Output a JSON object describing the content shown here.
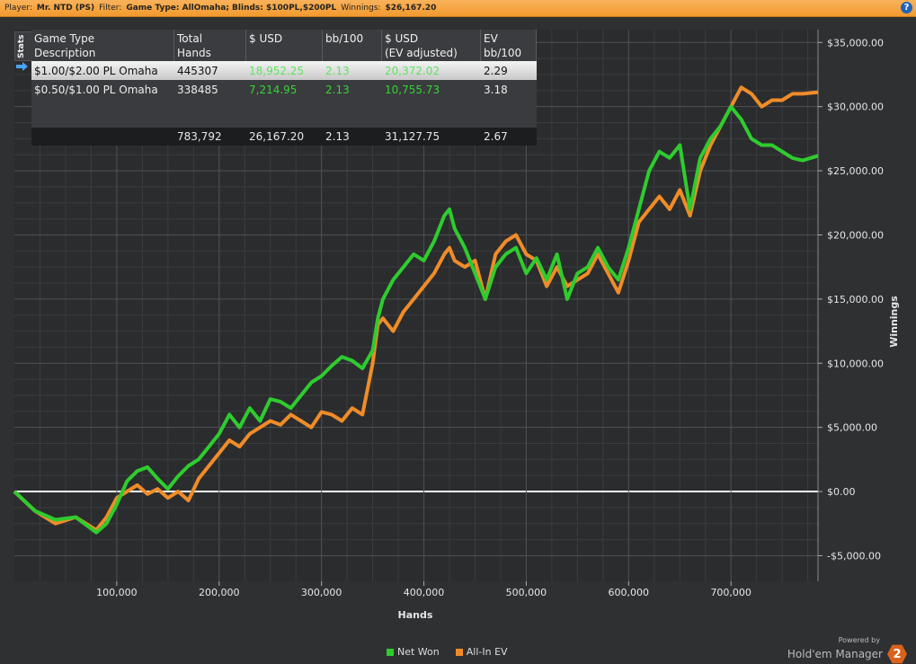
{
  "header": {
    "player_label": "Player:",
    "player_value": "Mr. NTD (PS)",
    "filter_label": "Filter:",
    "filter_value": "Game Type: AllOmaha; Blinds: $100PL,$200PL",
    "winnings_label": "Winnings:",
    "winnings_value": "$26,167.20",
    "help_glyph": "?"
  },
  "stats_tab": "Stats",
  "table": {
    "headers": [
      "Game Type\nDescription",
      "Total\nHands",
      "$ USD",
      "bb/100",
      "$ USD\n(EV adjusted)",
      "EV\nbb/100"
    ],
    "rows": [
      [
        "$1.00/$2.00 PL Omaha",
        "445307",
        "18,952.25",
        "2.13",
        "20,372.02",
        "2.29"
      ],
      [
        "$0.50/$1.00 PL Omaha",
        "338485",
        "7,214.95",
        "2.13",
        "10,755.73",
        "3.18"
      ]
    ],
    "totals": [
      "",
      "783,792",
      "26,167.20",
      "2.13",
      "31,127.75",
      "2.67"
    ]
  },
  "chart_data": {
    "type": "line",
    "xlabel": "Hands",
    "ylabel": "Winnings",
    "xlim": [
      0,
      785000
    ],
    "ylim": [
      -7000,
      36000
    ],
    "x_ticks": [
      100000,
      200000,
      300000,
      400000,
      500000,
      600000,
      700000
    ],
    "x_tick_labels": [
      "100,000",
      "200,000",
      "300,000",
      "400,000",
      "500,000",
      "600,000",
      "700,000"
    ],
    "y_ticks": [
      35000,
      30000,
      25000,
      20000,
      15000,
      10000,
      5000,
      0,
      -5000
    ],
    "y_tick_labels": [
      "$35,000.00",
      "$30,000.00",
      "$25,000.00",
      "$20,000.00",
      "$15,000.00",
      "$10,000.00",
      "$5,000.00",
      "$0.00",
      "-$5,000.00"
    ],
    "grid": true,
    "legend": "bottom-center",
    "series": [
      {
        "name": "Net Won",
        "color": "#2ecc2e",
        "x": [
          0,
          20000,
          40000,
          60000,
          80000,
          90000,
          100000,
          110000,
          120000,
          130000,
          140000,
          150000,
          160000,
          170000,
          180000,
          190000,
          200000,
          210000,
          220000,
          230000,
          240000,
          250000,
          260000,
          270000,
          280000,
          290000,
          300000,
          310000,
          320000,
          330000,
          340000,
          350000,
          355000,
          360000,
          370000,
          380000,
          390000,
          400000,
          410000,
          420000,
          425000,
          430000,
          440000,
          450000,
          460000,
          470000,
          480000,
          490000,
          500000,
          510000,
          520000,
          530000,
          540000,
          550000,
          560000,
          570000,
          580000,
          590000,
          600000,
          610000,
          620000,
          630000,
          640000,
          650000,
          660000,
          670000,
          680000,
          690000,
          700000,
          710000,
          720000,
          730000,
          740000,
          750000,
          760000,
          770000,
          785000
        ],
        "y": [
          0,
          -1500,
          -2200,
          -2000,
          -3200,
          -2500,
          -1000,
          800,
          1600,
          1900,
          1000,
          200,
          1200,
          2000,
          2500,
          3500,
          4500,
          6000,
          5000,
          6500,
          5500,
          7200,
          7000,
          6500,
          7500,
          8500,
          9000,
          9800,
          10500,
          10200,
          9600,
          11000,
          13500,
          15000,
          16500,
          17500,
          18500,
          18000,
          19500,
          21500,
          22000,
          20500,
          19000,
          17000,
          15000,
          17500,
          18500,
          19000,
          17000,
          18200,
          16500,
          18500,
          15000,
          17000,
          17500,
          19000,
          17500,
          16500,
          19000,
          22000,
          25000,
          26500,
          26000,
          27000,
          22000,
          26000,
          27500,
          28500,
          30000,
          29000,
          27500,
          27000,
          27000,
          26500,
          26000,
          25800,
          26167
        ]
      },
      {
        "name": "All-In EV",
        "color": "#f08c28",
        "x": [
          0,
          20000,
          40000,
          60000,
          80000,
          90000,
          100000,
          110000,
          120000,
          130000,
          140000,
          150000,
          160000,
          170000,
          180000,
          190000,
          200000,
          210000,
          220000,
          230000,
          240000,
          250000,
          260000,
          270000,
          280000,
          290000,
          300000,
          310000,
          320000,
          330000,
          340000,
          350000,
          355000,
          360000,
          370000,
          380000,
          390000,
          400000,
          410000,
          420000,
          425000,
          430000,
          440000,
          450000,
          460000,
          470000,
          480000,
          490000,
          500000,
          510000,
          520000,
          530000,
          540000,
          550000,
          560000,
          570000,
          580000,
          590000,
          600000,
          610000,
          620000,
          630000,
          640000,
          650000,
          660000,
          670000,
          680000,
          690000,
          700000,
          710000,
          720000,
          730000,
          740000,
          750000,
          760000,
          770000,
          785000
        ],
        "y": [
          0,
          -1500,
          -2500,
          -2000,
          -3000,
          -2000,
          -500,
          0,
          500,
          -200,
          200,
          -500,
          0,
          -700,
          1000,
          2000,
          3000,
          4000,
          3500,
          4500,
          5000,
          5500,
          5200,
          6000,
          5500,
          5000,
          6200,
          6000,
          5500,
          6500,
          6000,
          10000,
          13000,
          13500,
          12500,
          14000,
          15000,
          16000,
          17000,
          18500,
          19000,
          18000,
          17500,
          18000,
          15000,
          18500,
          19500,
          20000,
          18500,
          18000,
          16000,
          17500,
          16000,
          16500,
          17000,
          18500,
          17000,
          15500,
          18000,
          21000,
          22000,
          23000,
          22000,
          23500,
          21500,
          25000,
          27000,
          28500,
          30000,
          31500,
          31000,
          30000,
          30500,
          30500,
          31000,
          31000,
          31128
        ]
      }
    ]
  },
  "brand": {
    "powered_by": "Powered by",
    "name": "Hold'em Manager",
    "logo_text": "2"
  }
}
